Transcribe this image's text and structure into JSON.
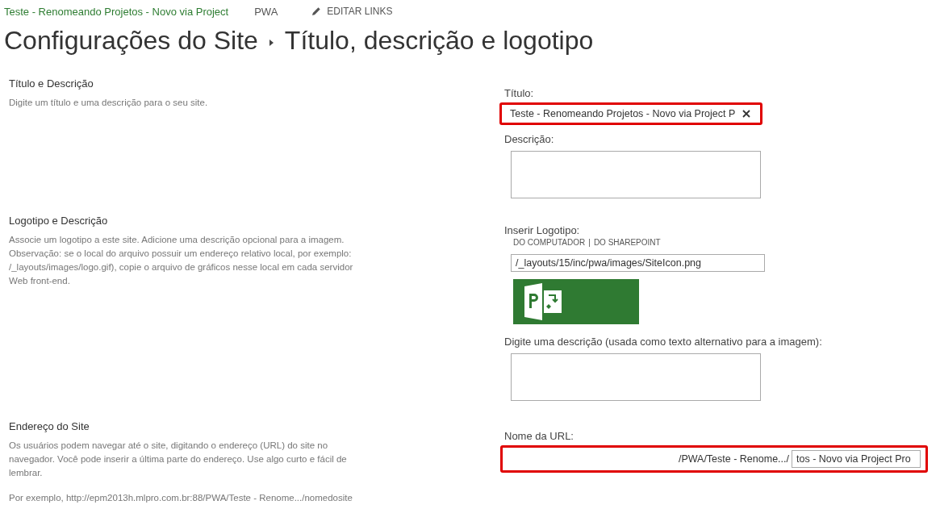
{
  "top_bar": {
    "site_link": "Teste - Renomeando Projetos - Novo via Project",
    "pwa_link": "PWA",
    "edit_links": "EDITAR LINKS"
  },
  "page_title": {
    "parent": "Configurações do Site",
    "current": "Título, descrição e logotipo"
  },
  "sections": [
    {
      "heading": "Título e Descrição",
      "paragraphs": [
        "Digite um título e uma descrição para o seu site."
      ],
      "fields": [
        {
          "kind": "text",
          "label": "Título:",
          "value": "Teste - Renomeando Projetos - Novo via Project P",
          "highlighted": true,
          "clearable": true
        },
        {
          "kind": "textarea",
          "label": "Descrição:",
          "highlighted": false
        }
      ]
    },
    {
      "heading": "Logotipo e Descrição",
      "paragraphs": [
        "Associe um logotipo a este site. Adicione uma descrição opcional para a imagem. Observação: se o local do arquivo possuir um endereço relativo local, por exemplo: /_layouts/images/logo.gif), copie o arquivo de gráficos nesse local em cada servidor Web front-end."
      ],
      "fields": [
        {
          "kind": "logo",
          "label": "Inserir Logotipo:",
          "sources": [
            "DO COMPUTADOR",
            "DO SHAREPOINT"
          ],
          "separator": "|",
          "value": "/_layouts/15/inc/pwa/images/SiteIcon.png",
          "highlighted": false
        },
        {
          "kind": "textarea",
          "label": "Digite uma descrição (usada como texto alternativo para a imagem):",
          "highlighted": false
        }
      ]
    },
    {
      "heading": "Endereço do Site",
      "paragraphs": [
        "Os usuários podem navegar até o site, digitando o endereço (URL) do site no navegador. Você pode inserir a última parte do endereço. Use algo curto e fácil de lembrar.",
        "Por exemplo, http://epm2013h.mlpro.com.br:88/PWA/Teste - Renome.../nomedosite"
      ],
      "fields": [
        {
          "kind": "url",
          "label": "Nome da URL:",
          "prefix": "/PWA/Teste - Renome.../",
          "value": "tos - Novo via Project Pro",
          "highlighted": true
        }
      ]
    }
  ]
}
